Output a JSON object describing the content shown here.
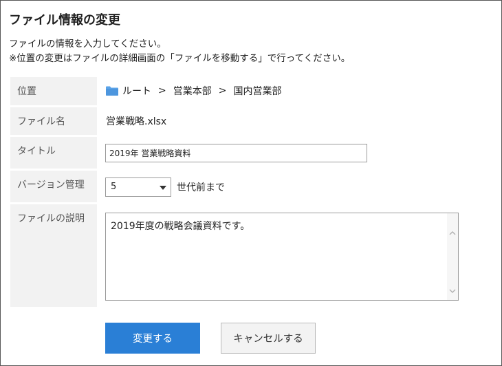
{
  "page": {
    "title": "ファイル情報の変更",
    "description_line1": "ファイルの情報を入力してください。",
    "description_line2": "※位置の変更はファイルの詳細画面の「ファイルを移動する」で行ってください。"
  },
  "form": {
    "location": {
      "label": "位置",
      "crumbs": [
        "ルート",
        "営業本部",
        "国内営業部"
      ],
      "separator": ">"
    },
    "filename": {
      "label": "ファイル名",
      "value": "営業戦略.xlsx"
    },
    "title": {
      "label": "タイトル",
      "value": "2019年 営業戦略資料"
    },
    "version": {
      "label": "バージョン管理",
      "selected": "5",
      "suffix": "世代前まで"
    },
    "description": {
      "label": "ファイルの説明",
      "value": "2019年度の戦略会議資料です。"
    }
  },
  "buttons": {
    "submit": "変更する",
    "cancel": "キャンセルする"
  },
  "colors": {
    "primary": "#2a7fd6",
    "label_bg": "#f2f2f2",
    "folder": "#5aa3e8"
  },
  "icons": {
    "folder": "folder-icon",
    "select_arrow": "chevron-down-icon",
    "scroll_up": "scroll-up-icon",
    "scroll_down": "scroll-down-icon"
  }
}
